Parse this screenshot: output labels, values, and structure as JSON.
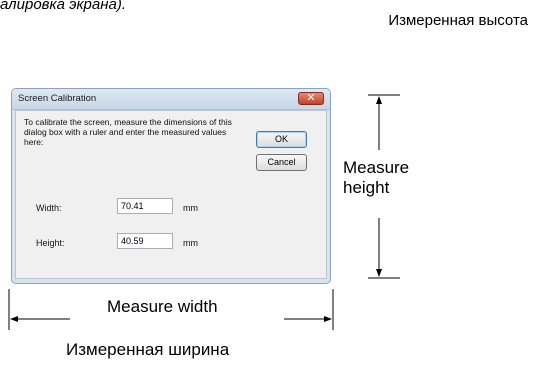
{
  "captions": {
    "top_fragment": "алировка экрана).",
    "ru_height": "Измеренная высота",
    "ru_width": "Измеренная ширина",
    "measure_height": "Measure height",
    "measure_width": "Measure width"
  },
  "dialog": {
    "title": "Screen Calibration",
    "close_symbol": "✕",
    "instructions": "To calibrate the screen, measure the dimensions of this dialog box with a ruler and enter the measured values here:",
    "ok_label": "OK",
    "cancel_label": "Cancel",
    "width_label": "Width:",
    "width_value": "70.41",
    "width_unit": "mm",
    "height_label": "Height:",
    "height_value": "40.59",
    "height_unit": "mm"
  }
}
